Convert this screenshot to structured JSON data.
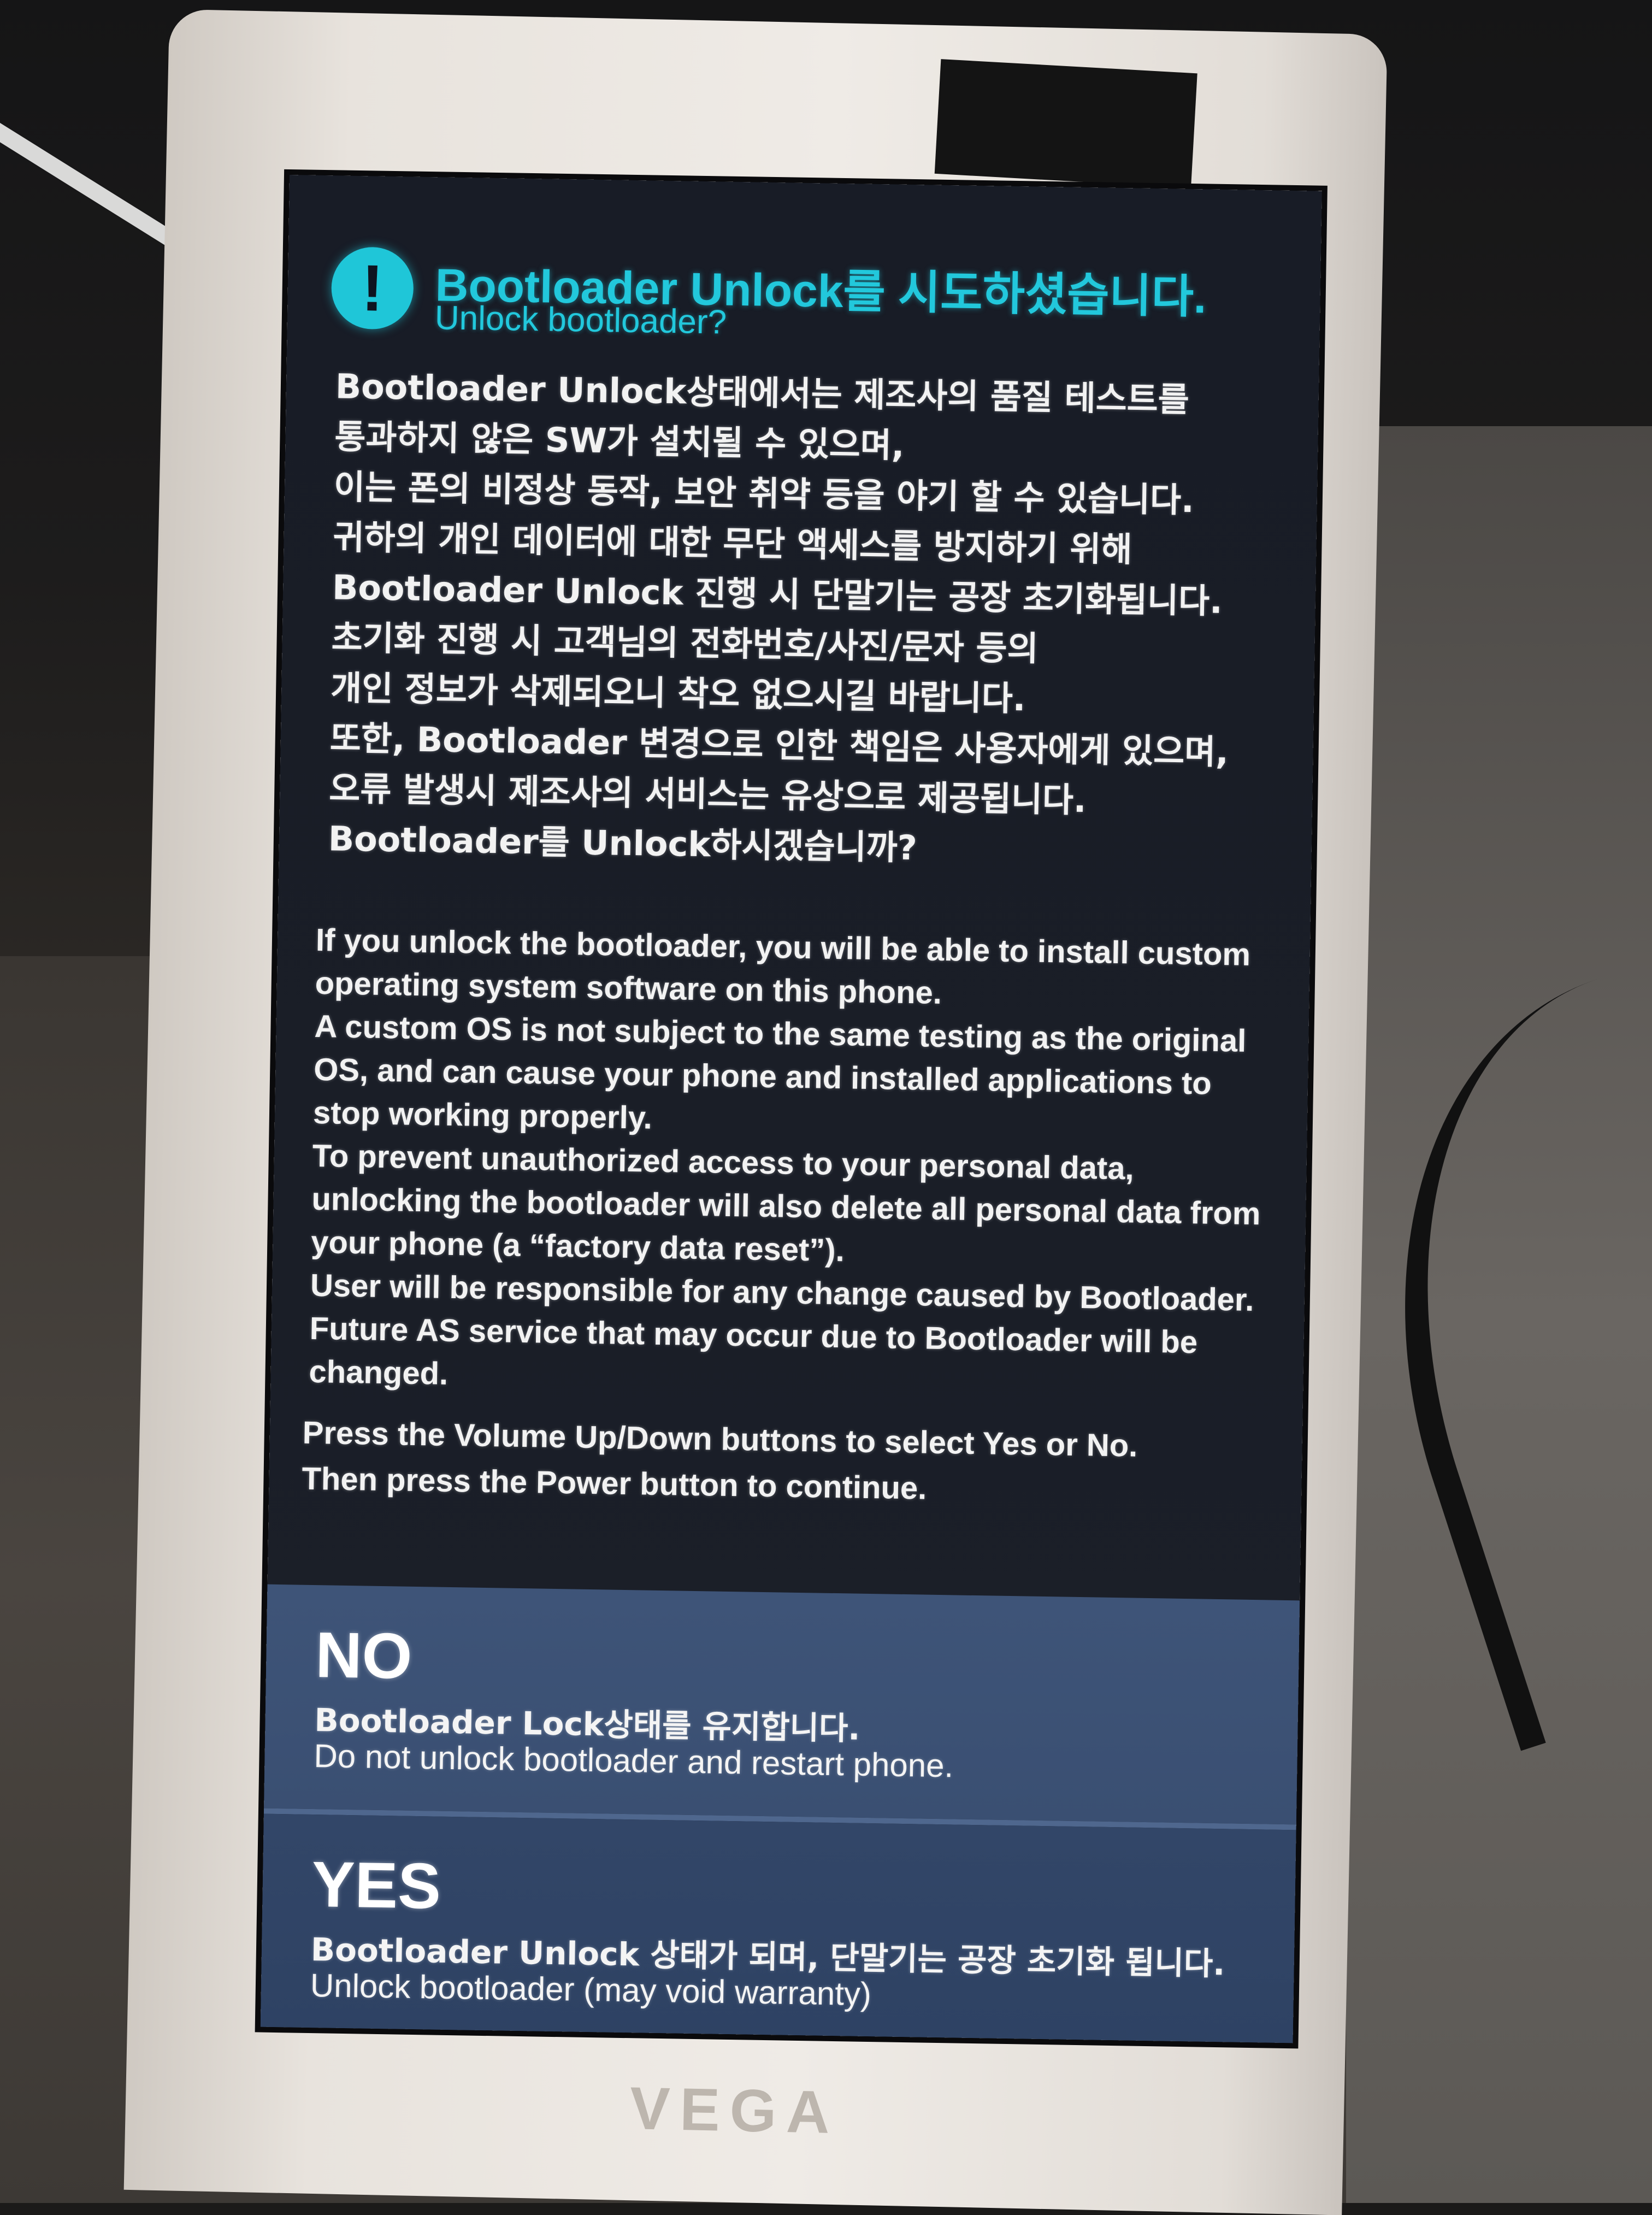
{
  "header": {
    "title": "Bootloader Unlock를 시도하셨습니다.",
    "subtitle": "Unlock bootloader?",
    "icon": "exclamation-icon",
    "accent_color": "#22c8dc"
  },
  "korean_message": [
    "Bootloader Unlock상태에서는 제조사의 품질 테스트를",
    "통과하지 않은 SW가 설치될 수 있으며,",
    "이는 폰의 비정상 동작, 보안 취약 등을 야기 할 수 있습니다.",
    "귀하의 개인 데이터에 대한 무단 액세스를 방지하기 위해",
    "Bootloader Unlock 진행 시 단말기는 공장 초기화됩니다.",
    "초기화 진행 시 고객님의 전화번호/사진/문자 등의",
    "개인 정보가 삭제되오니 착오 없으시길 바랍니다.",
    "또한, Bootloader 변경으로 인한 책임은 사용자에게 있으며,",
    "오류 발생시 제조사의 서비스는 유상으로 제공됩니다.",
    "Bootloader를 Unlock하시겠습니까?"
  ],
  "english_message": [
    "If you unlock the bootloader, you will be able to install custom",
    "operating system software on this phone.",
    "A custom OS is not subject to the same testing as the original",
    "OS, and can cause your phone and installed applications to",
    "stop working properly.",
    "To prevent unauthorized access to your personal data,",
    "unlocking the bootloader will also delete all personal data from",
    "your phone (a “factory data reset”).",
    "User will be responsible for any change caused by Bootloader.",
    "Future AS service that may occur due to Bootloader will be",
    "changed."
  ],
  "instructions": [
    "Press the Volume Up/Down buttons to select Yes or No.",
    "Then press the Power button to continue."
  ],
  "options": {
    "no": {
      "label": "NO",
      "ko": "Bootloader Lock상태를 유지합니다.",
      "en": "Do not unlock bootloader and restart phone."
    },
    "yes": {
      "label": "YES",
      "ko": "Bootloader Unlock 상태가 되며, 단말기는 공장 초기화 됩니다.",
      "en": "Unlock bootloader (may void warranty)"
    }
  },
  "device": {
    "brand_logo": "VEGA"
  },
  "colors": {
    "screen_bg": "#1a1e27",
    "option_bg": "#3e5478",
    "option_divider": "#4f678e"
  }
}
